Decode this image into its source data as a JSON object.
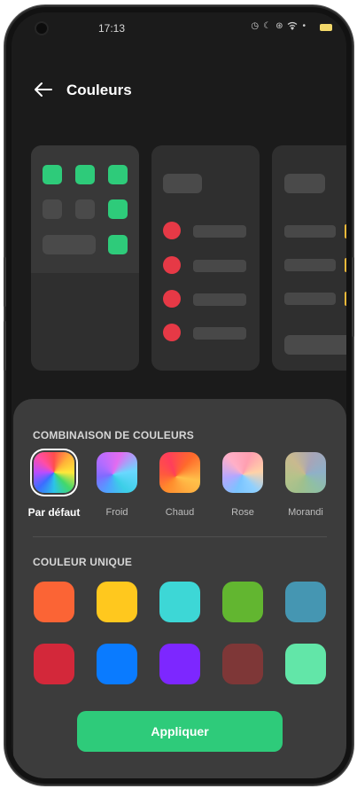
{
  "status_bar": {
    "time": "17:13",
    "icons": [
      "alarm-icon",
      "dnd-icon",
      "hotspot-icon",
      "wifi-icon",
      "battery-icon"
    ]
  },
  "header": {
    "title": "Couleurs"
  },
  "combo_section": {
    "title": "COMBINAISON DE COULEURS",
    "options": [
      {
        "label": "Par défaut",
        "selected": true
      },
      {
        "label": "Froid",
        "selected": false
      },
      {
        "label": "Chaud",
        "selected": false
      },
      {
        "label": "Rose",
        "selected": false
      },
      {
        "label": "Morandi",
        "selected": false
      }
    ]
  },
  "single_section": {
    "title": "COULEUR UNIQUE",
    "colors": [
      "#fb6435",
      "#ffc81e",
      "#3dd7d6",
      "#62b630",
      "#4596b2",
      "#d3283a",
      "#0a7bff",
      "#7d27ff",
      "#7e3737",
      "#62e6a8"
    ]
  },
  "apply_button": {
    "label": "Appliquer"
  },
  "colors": {
    "accent": "#2ecb7a",
    "preview_dot": "#e63946",
    "preview_badge": "#f0b93a"
  }
}
